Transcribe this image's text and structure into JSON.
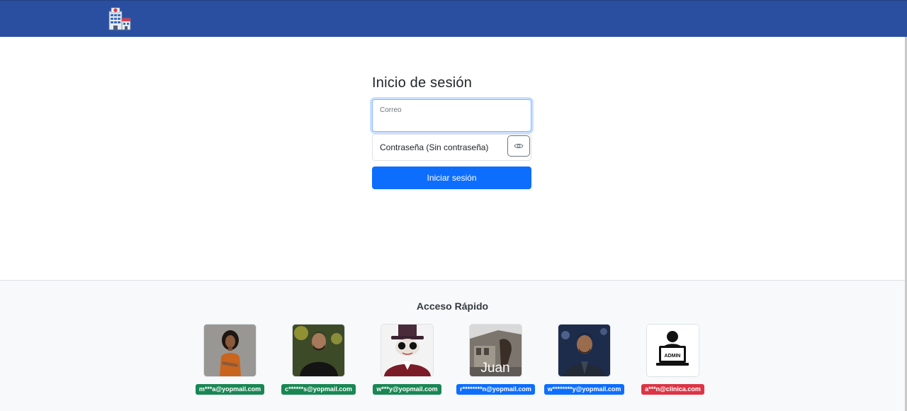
{
  "login": {
    "title": "Inicio de sesión",
    "email_label": "Correo",
    "email_value": "",
    "password_placeholder": "Contraseña (Sin contraseña)",
    "submit_label": "Iniciar sesión"
  },
  "quick_access": {
    "title": "Acceso Rápido",
    "users": [
      {
        "email": "m***a@yopmail.com",
        "badge_color": "#198754",
        "avatar": "woman-photo"
      },
      {
        "email": "c******s@yopmail.com",
        "badge_color": "#198754",
        "avatar": "man-photo"
      },
      {
        "email": "w***y@yopmail.com",
        "badge_color": "#198754",
        "avatar": "top-hat-character-photo"
      },
      {
        "email": "r********n@yopmail.com",
        "badge_color": "#0d6efd",
        "avatar": "juan-photo",
        "avatar_text": "Juan"
      },
      {
        "email": "w********y@yopmail.com",
        "badge_color": "#0d6efd",
        "avatar": "man-photo"
      },
      {
        "email": "a***n@clinica.com",
        "badge_color": "#dc3545",
        "avatar": "admin-laptop-icon",
        "avatar_text": "ADMIN"
      }
    ]
  },
  "colors": {
    "navbar": "#2b4fa0",
    "primary": "#0d6efd",
    "success": "#198754",
    "danger": "#dc3545"
  },
  "icons": {
    "logo": "hospital-building-icon",
    "toggle_password": "eye-icon"
  }
}
